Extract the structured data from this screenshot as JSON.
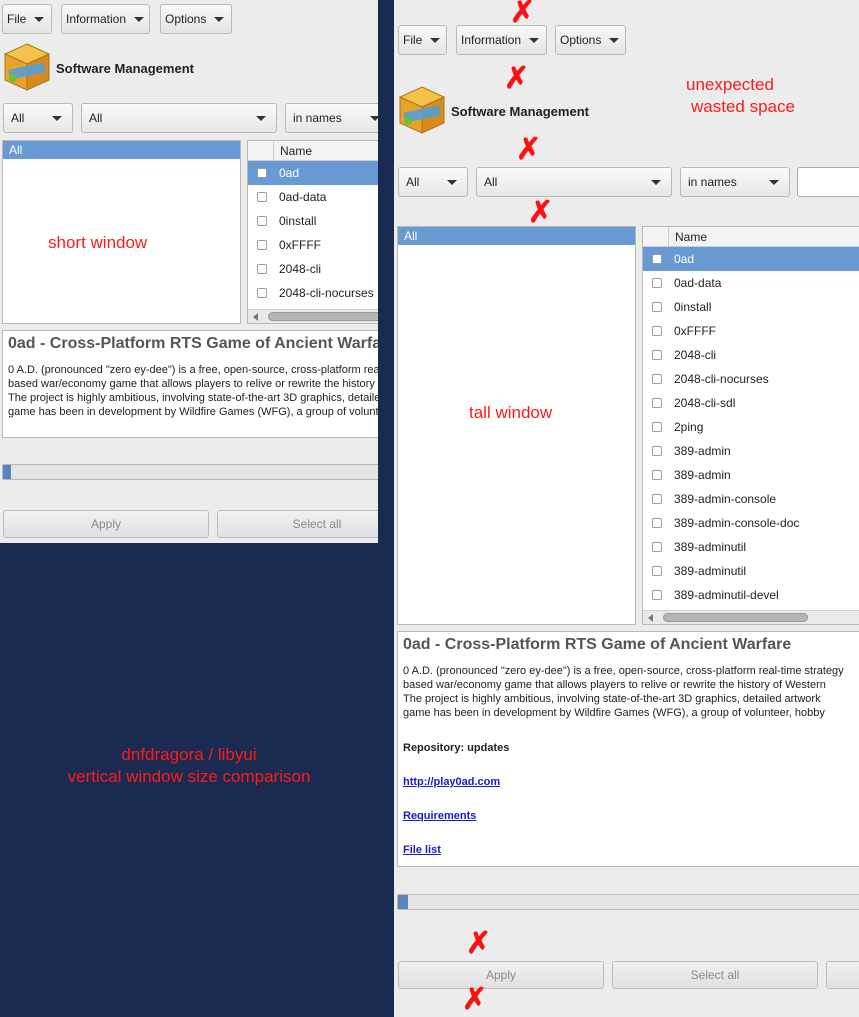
{
  "menus": [
    "File",
    "Information",
    "Options"
  ],
  "app_title": "Software Management",
  "filters": {
    "filter1": "All",
    "filter2": "All",
    "search_mode": "in names",
    "search_value": ""
  },
  "categories": {
    "selected": "All"
  },
  "table": {
    "column_name": "Name",
    "rows_short": [
      "0ad",
      "0ad-data",
      "0install",
      "0xFFFF",
      "2048-cli",
      "2048-cli-nocurses"
    ],
    "rows_tall": [
      "0ad",
      "0ad-data",
      "0install",
      "0xFFFF",
      "2048-cli",
      "2048-cli-nocurses",
      "2048-cli-sdl",
      "2ping",
      "389-admin",
      "389-admin",
      "389-admin-console",
      "389-admin-console-doc",
      "389-adminutil",
      "389-adminutil",
      "389-adminutil-devel"
    ],
    "selected_index": 0
  },
  "description": {
    "title": "0ad - Cross-Platform RTS Game of Ancient Warfare",
    "lines": [
      "0 A.D. (pronounced \"zero ey-dee\") is a free, open-source, cross-platform real-time strategy",
      "based war/economy game that allows players to relive or rewrite the history of Western",
      "The project is highly ambitious, involving state-of-the-art 3D graphics, detailed artwork",
      "game has been in development by Wildfire Games (WFG), a group of volunteer, hobby"
    ],
    "repository": "Repository: updates",
    "homepage": "http://play0ad.com",
    "requirements": "Requirements",
    "file_list": "File list"
  },
  "progress": 0.005,
  "buttons": {
    "apply": "Apply",
    "select_all": "Select all"
  },
  "annotations": {
    "short": "short window",
    "tall": "tall window",
    "wasted_1": "unexpected",
    "wasted_2": "wasted space",
    "caption_1": "dnfdragora / libyui",
    "caption_2": "vertical window size comparison"
  },
  "colors": {
    "selection": "#6a9ad3",
    "background": "#1a2a50",
    "annotation": "#ff1a1a"
  },
  "icons": [
    "dnfdragora-app-icon",
    "chevron-down-icon",
    "checkbox-icon",
    "scroll-left-arrow-icon",
    "x-mark-icon"
  ]
}
